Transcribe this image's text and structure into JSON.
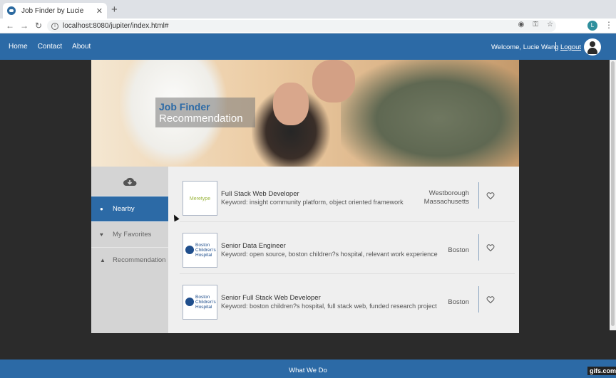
{
  "browser": {
    "tab_title": "Job Finder by Lucie",
    "url": "localhost:8080/jupiter/index.html#",
    "profile_initial": "L"
  },
  "nav": {
    "links": [
      "Home",
      "Contact",
      "About"
    ],
    "welcome": "Welcome, Lucie Wang",
    "logout": "Logout"
  },
  "hero": {
    "title_line1": "Job Finder",
    "title_line2": "Recommendation"
  },
  "sidebar": {
    "cloud_icon": "cloud-download-icon",
    "items": [
      {
        "label": "Nearby",
        "icon": "map-marker-icon",
        "active": true
      },
      {
        "label": "My Favorites",
        "icon": "heart-icon",
        "active": false
      },
      {
        "label": "Recommendation",
        "icon": "thumbs-up-icon",
        "active": false
      }
    ]
  },
  "jobs": [
    {
      "title": "Full Stack Web Developer",
      "keyword": "Keyword: insight community platform, object oriented framework",
      "location_line1": "Westborough",
      "location_line2": "Massachusetts",
      "logo": "company-logo"
    },
    {
      "title": "Senior Data Engineer",
      "keyword": "Keyword: open source, boston children?s hospital, relevant work experience",
      "location_line1": "Boston",
      "location_line2": "",
      "logo": "boston-childrens-hospital-logo"
    },
    {
      "title": "Senior Full Stack Web Developer",
      "keyword": "Keyword: boston children?s hospital, full stack web, funded research project",
      "location_line1": "Boston",
      "location_line2": "",
      "logo": "boston-childrens-hospital-logo"
    }
  ],
  "logo_text": {
    "company": "Meretype",
    "hospital_line1": "Boston",
    "hospital_line2": "Children's",
    "hospital_line3": "Hospital"
  },
  "footer": {
    "label": "What We Do"
  },
  "watermark": "gifs.com",
  "colors": {
    "primary": "#2c6aa6",
    "sidebar_bg": "#d4d4d4",
    "content_bg": "#efefef"
  }
}
